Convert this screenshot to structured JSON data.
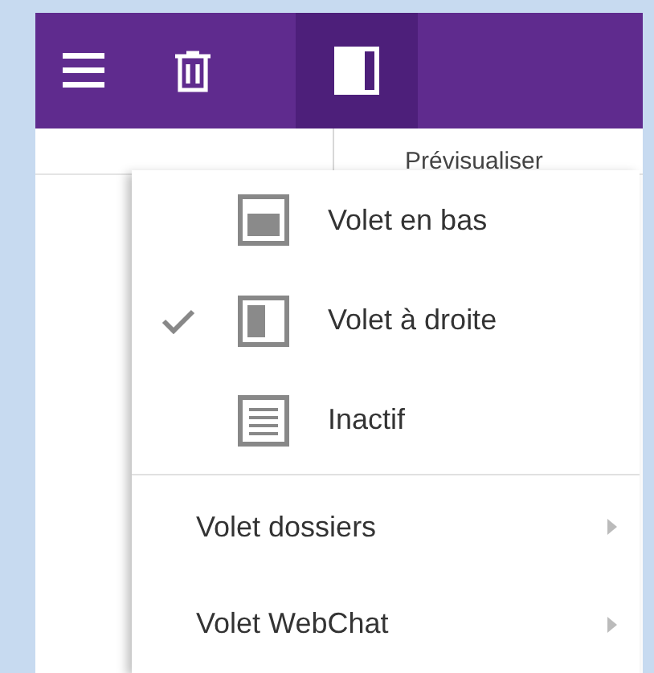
{
  "toolbar": {
    "buttons": [
      {
        "kind": "menu",
        "selected": false
      },
      {
        "kind": "delete",
        "selected": false
      },
      {
        "kind": "preview",
        "selected": true
      }
    ]
  },
  "tooltip": {
    "text": "Prévisualiser"
  },
  "menu": {
    "items": [
      {
        "kind": "bottom",
        "label": "Volet en bas",
        "checked": false
      },
      {
        "kind": "right",
        "label": "Volet à droite",
        "checked": true
      },
      {
        "kind": "none",
        "label": "Inactif",
        "checked": false
      },
      {
        "kind": "submenu",
        "label": "Volet dossiers"
      },
      {
        "kind": "submenu",
        "label": "Volet WebChat"
      }
    ]
  }
}
